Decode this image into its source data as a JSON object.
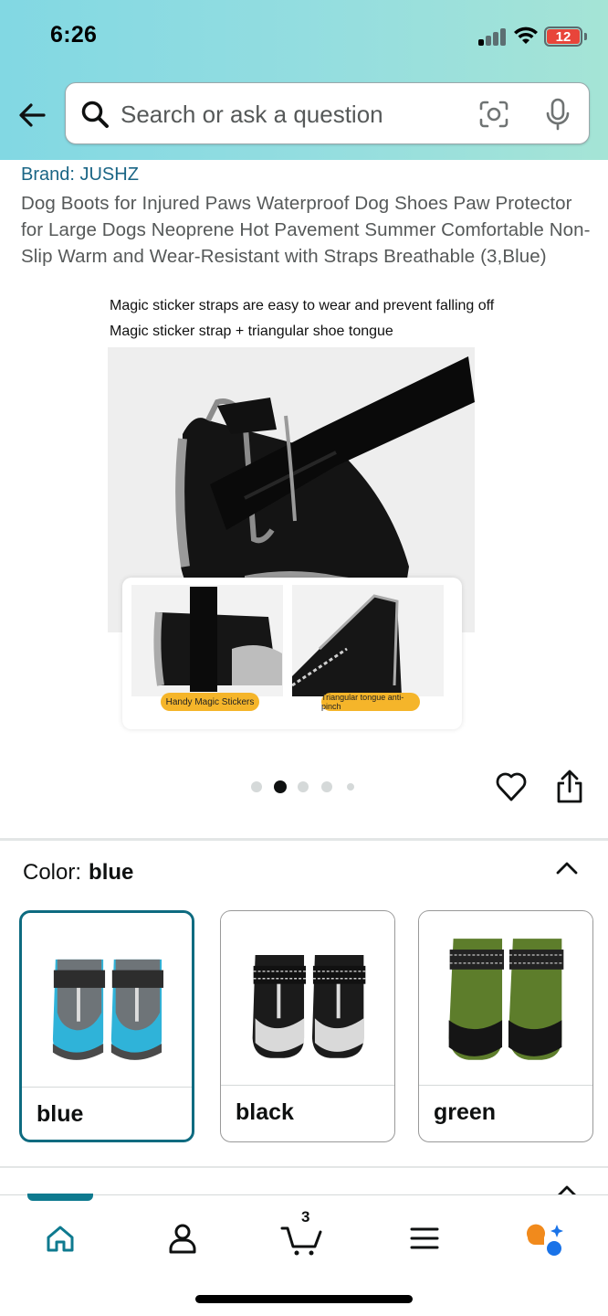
{
  "status_bar": {
    "time": "6:26",
    "battery": "12"
  },
  "search": {
    "placeholder": "Search or ask a question"
  },
  "product": {
    "brand": "Brand: JUSHZ",
    "title": "Dog Boots for Injured Paws Waterproof Dog Shoes Paw Protector for Large Dogs Neoprene Hot Pavement Summer Comfortable Non-Slip Warm and Wear-Resistant with Straps Breathable (3,Blue)"
  },
  "image": {
    "caption_1": "Magic sticker straps are easy to wear and prevent falling off",
    "caption_2": "Magic sticker strap + triangular shoe tongue",
    "tag_1": "Handy Magic Stickers",
    "tag_2": "Triangular tongue anti-pinch"
  },
  "carousel": {
    "total": 5,
    "active_index": 1
  },
  "color": {
    "label": "Color:",
    "selected": "blue",
    "options": [
      {
        "label": "blue",
        "accent": "#2fb3d9"
      },
      {
        "label": "black",
        "accent": "#222222"
      },
      {
        "label": "green",
        "accent": "#5d7d2b"
      }
    ]
  },
  "nav": {
    "cart_count": "3",
    "items": [
      "home-icon",
      "account-icon",
      "cart-icon",
      "menu-icon",
      "rufus-icon"
    ]
  },
  "colors": {
    "accent": "#0e7a8f",
    "brand_link": "#1a6585",
    "header_start": "#82d8e3",
    "header_end": "#a5e4d6",
    "battery": "#e8453a"
  }
}
